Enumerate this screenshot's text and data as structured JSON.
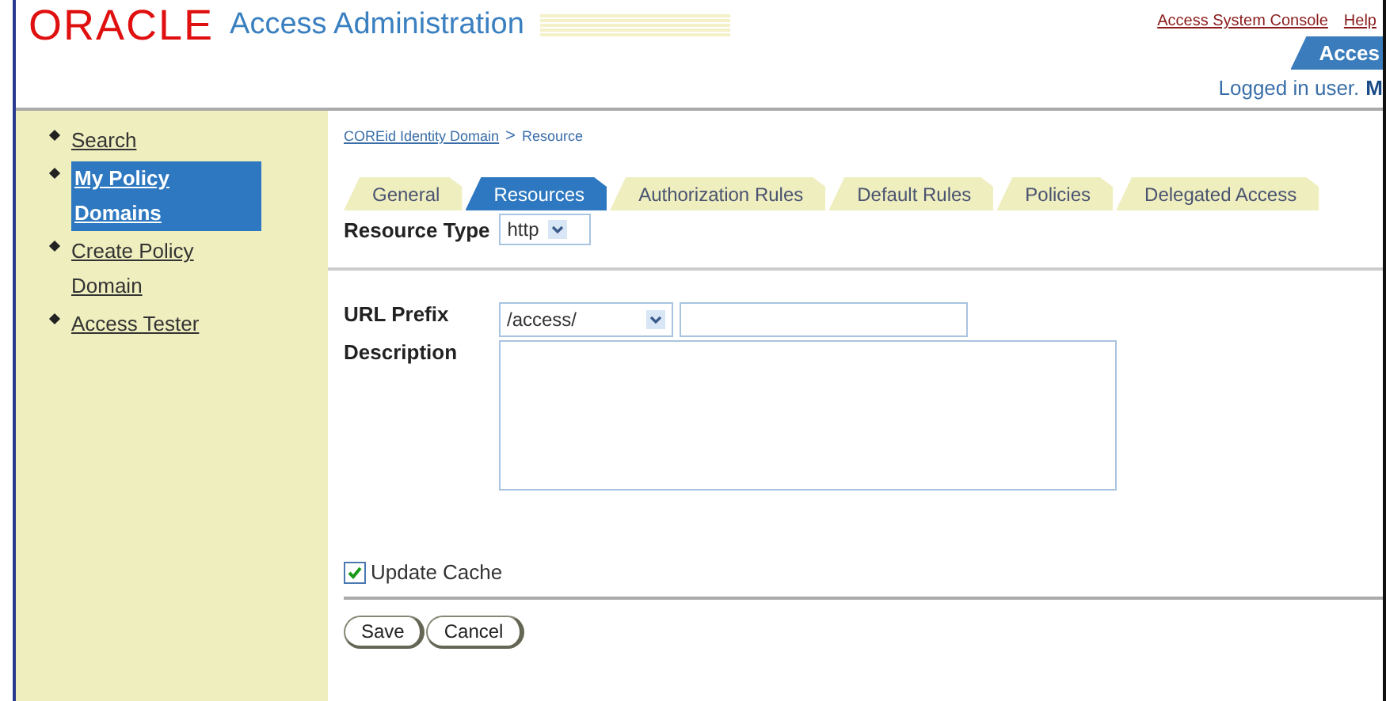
{
  "header": {
    "logo": "ORACLE",
    "title": "Access Administration",
    "links": [
      "Access System Console",
      "Help"
    ],
    "app_tab": "Acces",
    "logged_in_label": "Logged in user.",
    "logged_in_user": "M"
  },
  "sidebar": {
    "items": [
      {
        "label": "Search",
        "selected": false
      },
      {
        "label": "My Policy Domains",
        "selected": true
      },
      {
        "label": "Create Policy Domain",
        "selected": false
      },
      {
        "label": "Access Tester",
        "selected": false
      }
    ]
  },
  "breadcrumb": {
    "link": "COREid Identity Domain",
    "separator": ">",
    "current": "Resource"
  },
  "tabs": [
    {
      "label": "General",
      "selected": false
    },
    {
      "label": "Resources",
      "selected": true
    },
    {
      "label": "Authorization Rules",
      "selected": false
    },
    {
      "label": "Default Rules",
      "selected": false
    },
    {
      "label": "Policies",
      "selected": false
    },
    {
      "label": "Delegated Access",
      "selected": false
    }
  ],
  "resource_type": {
    "label": "Resource Type",
    "value": "http"
  },
  "url_prefix": {
    "label": "URL Prefix",
    "value": "/access/"
  },
  "description": {
    "label": "Description"
  },
  "update_cache": {
    "label": "Update Cache",
    "checked": true
  },
  "buttons": [
    "Save",
    "Cancel"
  ]
}
